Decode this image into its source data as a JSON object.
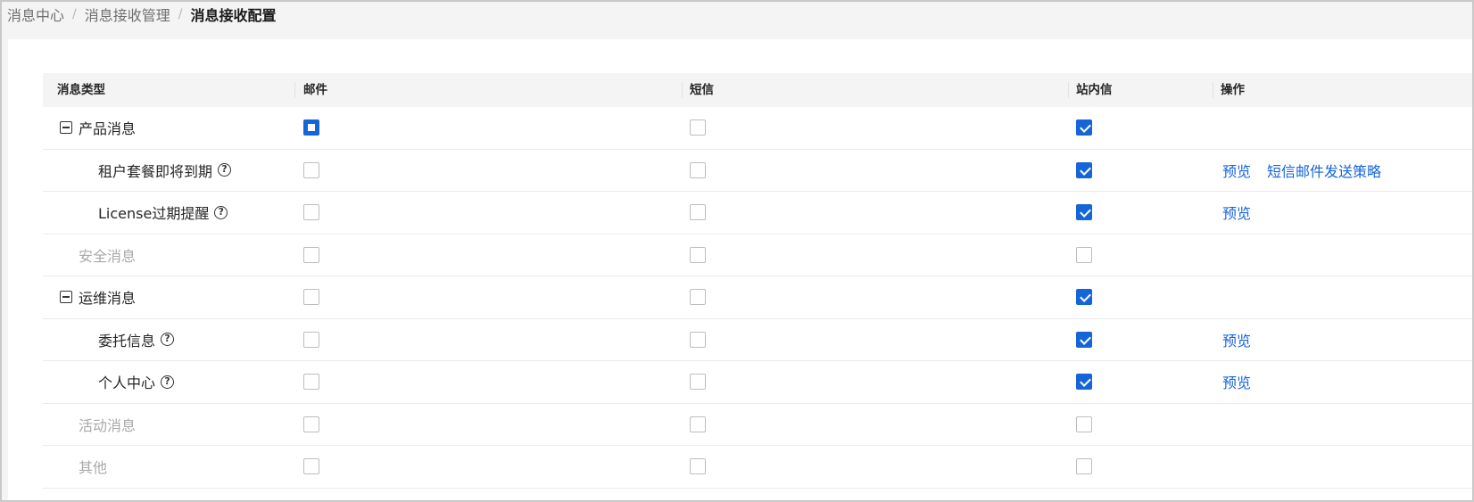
{
  "breadcrumb": [
    "消息中心",
    "消息接收管理",
    "消息接收配置"
  ],
  "table": {
    "headers": {
      "type": "消息类型",
      "email": "邮件",
      "sms": "短信",
      "inbox": "站内信",
      "actions": "操作"
    },
    "rows": [
      {
        "label": "产品消息",
        "level": 0,
        "expandable": true,
        "disabled": false,
        "help": false,
        "email": "indeterminate",
        "sms": "unchecked",
        "inbox": "checked",
        "actions": []
      },
      {
        "label": "租户套餐即将到期",
        "level": 1,
        "expandable": false,
        "disabled": false,
        "help": true,
        "email": "unchecked",
        "sms": "unchecked",
        "inbox": "checked",
        "actions": [
          "预览",
          "短信邮件发送策略"
        ]
      },
      {
        "label": "License过期提醒",
        "level": 1,
        "expandable": false,
        "disabled": false,
        "help": true,
        "email": "unchecked",
        "sms": "unchecked",
        "inbox": "checked",
        "actions": [
          "预览"
        ]
      },
      {
        "label": "安全消息",
        "level": 0,
        "expandable": false,
        "disabled": true,
        "help": false,
        "email": "unchecked",
        "sms": "unchecked",
        "inbox": "unchecked",
        "actions": []
      },
      {
        "label": "运维消息",
        "level": 0,
        "expandable": true,
        "disabled": false,
        "help": false,
        "email": "unchecked",
        "sms": "unchecked",
        "inbox": "checked",
        "actions": []
      },
      {
        "label": "委托信息",
        "level": 1,
        "expandable": false,
        "disabled": false,
        "help": true,
        "email": "unchecked",
        "sms": "unchecked",
        "inbox": "checked",
        "actions": [
          "预览"
        ]
      },
      {
        "label": "个人中心",
        "level": 1,
        "expandable": false,
        "disabled": false,
        "help": true,
        "email": "unchecked",
        "sms": "unchecked",
        "inbox": "checked",
        "actions": [
          "预览"
        ]
      },
      {
        "label": "活动消息",
        "level": 0,
        "expandable": false,
        "disabled": true,
        "help": false,
        "email": "unchecked",
        "sms": "unchecked",
        "inbox": "unchecked",
        "actions": []
      },
      {
        "label": "其他",
        "level": 0,
        "expandable": false,
        "disabled": true,
        "help": false,
        "email": "unchecked",
        "sms": "unchecked",
        "inbox": "unchecked",
        "actions": []
      }
    ]
  },
  "icons": {
    "collapse": "minus-square-icon",
    "help": "question-circle-icon"
  },
  "colors": {
    "primary": "#1565d8",
    "disabled_text": "#a9a9a9",
    "header_bg": "#f4f4f4"
  }
}
